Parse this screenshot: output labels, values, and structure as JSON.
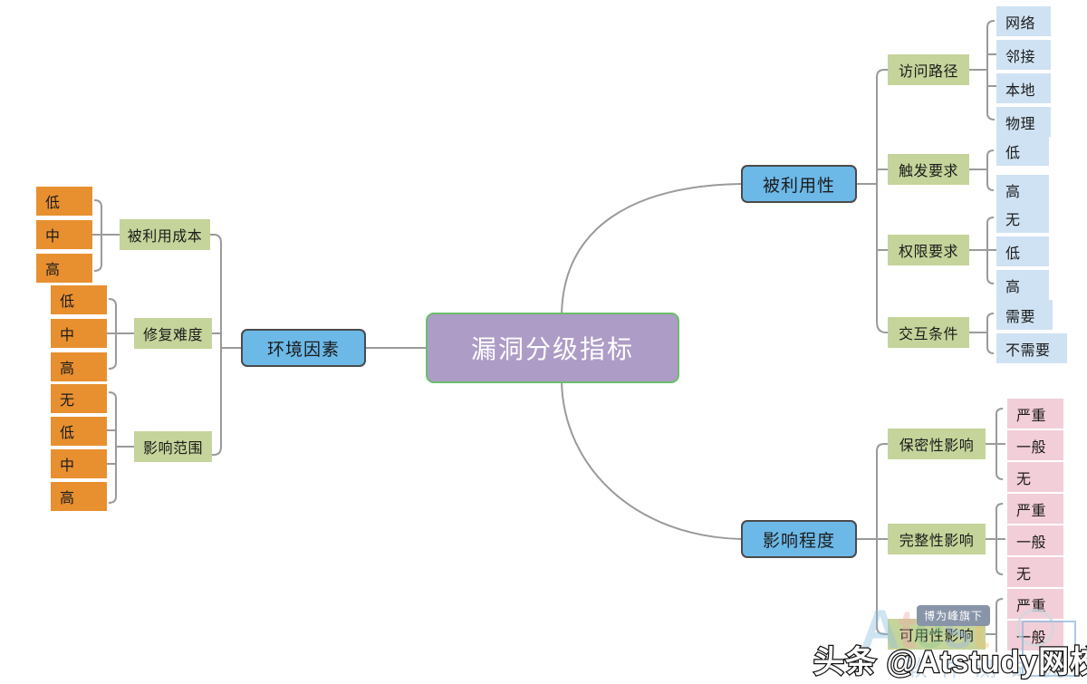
{
  "diagram": {
    "type": "mindmap",
    "root": {
      "label": "漏洞分级指标",
      "color": "#ad9cc6",
      "border": "#6abf6a",
      "text_color": "#ffffff"
    },
    "colors": {
      "main_node": "#6cb9e8",
      "sub_node": "#c5d49a",
      "leaf_blue": "#cfe2f3",
      "leaf_pink": "#f2ced8",
      "leaf_orange": "#e8902f",
      "link": "#9a9a9a"
    },
    "branches": [
      {
        "label": "被利用性",
        "side": "right",
        "children": [
          {
            "label": "访问路径",
            "leaf_style": "leaf_blue",
            "leaves": [
              "网络",
              "邻接",
              "本地",
              "物理"
            ]
          },
          {
            "label": "触发要求",
            "leaf_style": "leaf_blue",
            "leaves": [
              "低",
              "高"
            ]
          },
          {
            "label": "权限要求",
            "leaf_style": "leaf_blue",
            "leaves": [
              "无",
              "低",
              "高"
            ]
          },
          {
            "label": "交互条件",
            "leaf_style": "leaf_blue",
            "leaves": [
              "需要",
              "不需要"
            ]
          }
        ]
      },
      {
        "label": "影响程度",
        "side": "right",
        "children": [
          {
            "label": "保密性影响",
            "leaf_style": "leaf_pink",
            "leaves": [
              "严重",
              "一般",
              "无"
            ]
          },
          {
            "label": "完整性影响",
            "leaf_style": "leaf_pink",
            "leaves": [
              "严重",
              "一般",
              "无"
            ]
          },
          {
            "label": "可用性影响",
            "leaf_style": "leaf_pink",
            "leaves": [
              "严重",
              "一般"
            ]
          }
        ]
      },
      {
        "label": "环境因素",
        "side": "left",
        "children": [
          {
            "label": "被利用成本",
            "leaf_style": "leaf_orange",
            "leaves": [
              "低",
              "中",
              "高"
            ]
          },
          {
            "label": "修复难度",
            "leaf_style": "leaf_orange",
            "leaves": [
              "低",
              "中",
              "高"
            ]
          },
          {
            "label": "影响范围",
            "leaf_style": "leaf_orange",
            "leaves": [
              "无",
              "低",
              "中",
              "高"
            ]
          }
        ]
      }
    ]
  },
  "watermarks": {
    "badge": "博为峰旗下",
    "logo_parts": [
      "A",
      "t",
      "e",
      "s",
      "t"
    ],
    "logo_sub": "软件测试网",
    "bottom": "头条 @Atstudy网校"
  }
}
